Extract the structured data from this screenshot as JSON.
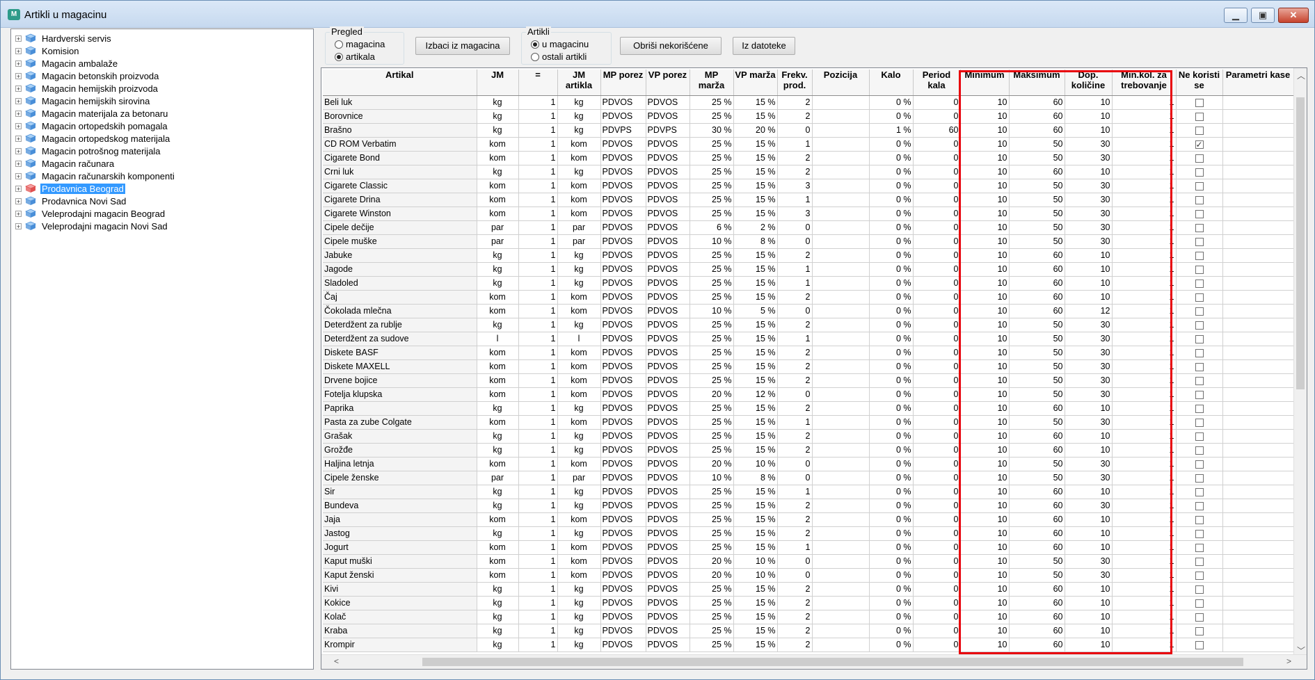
{
  "window": {
    "title": "Artikli u magacinu",
    "minimize": "▁",
    "maximize": "▣",
    "close": "✕",
    "app_icon_text": "M"
  },
  "tree": {
    "items": [
      {
        "label": "Hardverski servis"
      },
      {
        "label": "Komision"
      },
      {
        "label": "Magacin ambalaže"
      },
      {
        "label": "Magacin betonskih proizvoda"
      },
      {
        "label": "Magacin hemijskih proizvoda"
      },
      {
        "label": "Magacin hemijskih sirovina"
      },
      {
        "label": "Magacin materijala za betonaru"
      },
      {
        "label": "Magacin ortopedskih pomagala"
      },
      {
        "label": "Magacin ortopedskog materijala"
      },
      {
        "label": "Magacin potrošnog materijala"
      },
      {
        "label": "Magacin računara"
      },
      {
        "label": "Magacin računarskih komponenti"
      },
      {
        "label": "Prodavnica Beograd",
        "selected": true
      },
      {
        "label": "Prodavnica Novi Sad"
      },
      {
        "label": "Veleprodajni magacin Beograd"
      },
      {
        "label": "Veleprodajni magacin Novi Sad"
      }
    ]
  },
  "pregled": {
    "title": "Pregled",
    "opt1": "magacina",
    "opt2": "artikala",
    "selected": "artikala"
  },
  "izbaci_button": "Izbaci iz magacina",
  "artikli": {
    "title": "Artikli",
    "opt1": "u magacinu",
    "opt2": "ostali artikli",
    "selected": "u magacinu"
  },
  "obrisi_button": "Obriši nekorišćene",
  "iz_datoteke_button": "Iz datoteke",
  "columns": [
    "Artikal",
    "JM",
    "=",
    "JM artikla",
    "MP porez",
    "VP porez",
    "MP marža",
    "VP marža",
    "Frekv. prod.",
    "Pozicija",
    "Kalo",
    "Period kala",
    "Minimum",
    "Maksimum",
    "Dop. količine",
    "Min.kol. za trebovanje",
    "Ne koristi se",
    "Parametri kase"
  ],
  "rows": [
    [
      "Beli luk",
      "kg",
      "1",
      "kg",
      "PDVOS",
      "PDVOS",
      "25 %",
      "15 %",
      "2",
      "",
      "0 %",
      "0",
      "10",
      "60",
      "10",
      "1",
      false
    ],
    [
      "Borovnice",
      "kg",
      "1",
      "kg",
      "PDVOS",
      "PDVOS",
      "25 %",
      "15 %",
      "2",
      "",
      "0 %",
      "0",
      "10",
      "60",
      "10",
      "1",
      false
    ],
    [
      "Brašno",
      "kg",
      "1",
      "kg",
      "PDVPS",
      "PDVPS",
      "30 %",
      "20 %",
      "0",
      "",
      "1 %",
      "60",
      "10",
      "60",
      "10",
      "1",
      false
    ],
    [
      "CD ROM Verbatim",
      "kom",
      "1",
      "kom",
      "PDVOS",
      "PDVOS",
      "25 %",
      "15 %",
      "1",
      "",
      "0 %",
      "0",
      "10",
      "50",
      "30",
      "1",
      true
    ],
    [
      "Cigarete Bond",
      "kom",
      "1",
      "kom",
      "PDVOS",
      "PDVOS",
      "25 %",
      "15 %",
      "2",
      "",
      "0 %",
      "0",
      "10",
      "50",
      "30",
      "1",
      false
    ],
    [
      "Crni luk",
      "kg",
      "1",
      "kg",
      "PDVOS",
      "PDVOS",
      "25 %",
      "15 %",
      "2",
      "",
      "0 %",
      "0",
      "10",
      "60",
      "10",
      "1",
      false
    ],
    [
      "Cigarete Classic",
      "kom",
      "1",
      "kom",
      "PDVOS",
      "PDVOS",
      "25 %",
      "15 %",
      "3",
      "",
      "0 %",
      "0",
      "10",
      "50",
      "30",
      "1",
      false
    ],
    [
      "Cigarete Drina",
      "kom",
      "1",
      "kom",
      "PDVOS",
      "PDVOS",
      "25 %",
      "15 %",
      "1",
      "",
      "0 %",
      "0",
      "10",
      "50",
      "30",
      "1",
      false
    ],
    [
      "Cigarete Winston",
      "kom",
      "1",
      "kom",
      "PDVOS",
      "PDVOS",
      "25 %",
      "15 %",
      "3",
      "",
      "0 %",
      "0",
      "10",
      "50",
      "30",
      "1",
      false
    ],
    [
      "Cipele dečije",
      "par",
      "1",
      "par",
      "PDVOS",
      "PDVOS",
      "6 %",
      "2 %",
      "0",
      "",
      "0 %",
      "0",
      "10",
      "50",
      "30",
      "1",
      false
    ],
    [
      "Cipele muške",
      "par",
      "1",
      "par",
      "PDVOS",
      "PDVOS",
      "10 %",
      "8 %",
      "0",
      "",
      "0 %",
      "0",
      "10",
      "50",
      "30",
      "1",
      false
    ],
    [
      "Jabuke",
      "kg",
      "1",
      "kg",
      "PDVOS",
      "PDVOS",
      "25 %",
      "15 %",
      "2",
      "",
      "0 %",
      "0",
      "10",
      "60",
      "10",
      "1",
      false
    ],
    [
      "Jagode",
      "kg",
      "1",
      "kg",
      "PDVOS",
      "PDVOS",
      "25 %",
      "15 %",
      "1",
      "",
      "0 %",
      "0",
      "10",
      "60",
      "10",
      "1",
      false
    ],
    [
      "Sladoled",
      "kg",
      "1",
      "kg",
      "PDVOS",
      "PDVOS",
      "25 %",
      "15 %",
      "1",
      "",
      "0 %",
      "0",
      "10",
      "60",
      "10",
      "1",
      false
    ],
    [
      "Čaj",
      "kom",
      "1",
      "kom",
      "PDVOS",
      "PDVOS",
      "25 %",
      "15 %",
      "2",
      "",
      "0 %",
      "0",
      "10",
      "60",
      "10",
      "1",
      false
    ],
    [
      "Čokolada mlečna",
      "kom",
      "1",
      "kom",
      "PDVOS",
      "PDVOS",
      "10 %",
      "5 %",
      "0",
      "",
      "0 %",
      "0",
      "10",
      "60",
      "12",
      "1",
      false
    ],
    [
      "Deterdžent za rublje",
      "kg",
      "1",
      "kg",
      "PDVOS",
      "PDVOS",
      "25 %",
      "15 %",
      "2",
      "",
      "0 %",
      "0",
      "10",
      "50",
      "30",
      "1",
      false
    ],
    [
      "Deterdžent za sudove",
      "l",
      "1",
      "l",
      "PDVOS",
      "PDVOS",
      "25 %",
      "15 %",
      "1",
      "",
      "0 %",
      "0",
      "10",
      "50",
      "30",
      "1",
      false
    ],
    [
      "Diskete BASF",
      "kom",
      "1",
      "kom",
      "PDVOS",
      "PDVOS",
      "25 %",
      "15 %",
      "2",
      "",
      "0 %",
      "0",
      "10",
      "50",
      "30",
      "1",
      false
    ],
    [
      "Diskete MAXELL",
      "kom",
      "1",
      "kom",
      "PDVOS",
      "PDVOS",
      "25 %",
      "15 %",
      "2",
      "",
      "0 %",
      "0",
      "10",
      "50",
      "30",
      "1",
      false
    ],
    [
      "Drvene bojice",
      "kom",
      "1",
      "kom",
      "PDVOS",
      "PDVOS",
      "25 %",
      "15 %",
      "2",
      "",
      "0 %",
      "0",
      "10",
      "50",
      "30",
      "1",
      false
    ],
    [
      "Fotelja klupska",
      "kom",
      "1",
      "kom",
      "PDVOS",
      "PDVOS",
      "20 %",
      "12 %",
      "0",
      "",
      "0 %",
      "0",
      "10",
      "50",
      "30",
      "1",
      false
    ],
    [
      "Paprika",
      "kg",
      "1",
      "kg",
      "PDVOS",
      "PDVOS",
      "25 %",
      "15 %",
      "2",
      "",
      "0 %",
      "0",
      "10",
      "60",
      "10",
      "1",
      false
    ],
    [
      "Pasta za zube Colgate",
      "kom",
      "1",
      "kom",
      "PDVOS",
      "PDVOS",
      "25 %",
      "15 %",
      "1",
      "",
      "0 %",
      "0",
      "10",
      "50",
      "30",
      "1",
      false
    ],
    [
      "Grašak",
      "kg",
      "1",
      "kg",
      "PDVOS",
      "PDVOS",
      "25 %",
      "15 %",
      "2",
      "",
      "0 %",
      "0",
      "10",
      "60",
      "10",
      "1",
      false
    ],
    [
      "Grožđe",
      "kg",
      "1",
      "kg",
      "PDVOS",
      "PDVOS",
      "25 %",
      "15 %",
      "2",
      "",
      "0 %",
      "0",
      "10",
      "60",
      "10",
      "1",
      false
    ],
    [
      "Haljina letnja",
      "kom",
      "1",
      "kom",
      "PDVOS",
      "PDVOS",
      "20 %",
      "10 %",
      "0",
      "",
      "0 %",
      "0",
      "10",
      "50",
      "30",
      "1",
      false
    ],
    [
      "Cipele ženske",
      "par",
      "1",
      "par",
      "PDVOS",
      "PDVOS",
      "10 %",
      "8 %",
      "0",
      "",
      "0 %",
      "0",
      "10",
      "50",
      "30",
      "1",
      false
    ],
    [
      "Sir",
      "kg",
      "1",
      "kg",
      "PDVOS",
      "PDVOS",
      "25 %",
      "15 %",
      "1",
      "",
      "0 %",
      "0",
      "10",
      "60",
      "10",
      "1",
      false
    ],
    [
      "Bundeva",
      "kg",
      "1",
      "kg",
      "PDVOS",
      "PDVOS",
      "25 %",
      "15 %",
      "2",
      "",
      "0 %",
      "0",
      "10",
      "60",
      "30",
      "1",
      false
    ],
    [
      "Jaja",
      "kom",
      "1",
      "kom",
      "PDVOS",
      "PDVOS",
      "25 %",
      "15 %",
      "2",
      "",
      "0 %",
      "0",
      "10",
      "60",
      "10",
      "1",
      false
    ],
    [
      "Jastog",
      "kg",
      "1",
      "kg",
      "PDVOS",
      "PDVOS",
      "25 %",
      "15 %",
      "2",
      "",
      "0 %",
      "0",
      "10",
      "60",
      "10",
      "1",
      false
    ],
    [
      "Jogurt",
      "kom",
      "1",
      "kom",
      "PDVOS",
      "PDVOS",
      "25 %",
      "15 %",
      "1",
      "",
      "0 %",
      "0",
      "10",
      "60",
      "10",
      "1",
      false
    ],
    [
      "Kaput muški",
      "kom",
      "1",
      "kom",
      "PDVOS",
      "PDVOS",
      "20 %",
      "10 %",
      "0",
      "",
      "0 %",
      "0",
      "10",
      "50",
      "30",
      "1",
      false
    ],
    [
      "Kaput ženski",
      "kom",
      "1",
      "kom",
      "PDVOS",
      "PDVOS",
      "20 %",
      "10 %",
      "0",
      "",
      "0 %",
      "0",
      "10",
      "50",
      "30",
      "1",
      false
    ],
    [
      "Kivi",
      "kg",
      "1",
      "kg",
      "PDVOS",
      "PDVOS",
      "25 %",
      "15 %",
      "2",
      "",
      "0 %",
      "0",
      "10",
      "60",
      "10",
      "1",
      false
    ],
    [
      "Kokice",
      "kg",
      "1",
      "kg",
      "PDVOS",
      "PDVOS",
      "25 %",
      "15 %",
      "2",
      "",
      "0 %",
      "0",
      "10",
      "60",
      "10",
      "1",
      false
    ],
    [
      "Kolač",
      "kg",
      "1",
      "kg",
      "PDVOS",
      "PDVOS",
      "25 %",
      "15 %",
      "2",
      "",
      "0 %",
      "0",
      "10",
      "60",
      "10",
      "1",
      false
    ],
    [
      "Kraba",
      "kg",
      "1",
      "kg",
      "PDVOS",
      "PDVOS",
      "25 %",
      "15 %",
      "2",
      "",
      "0 %",
      "0",
      "10",
      "60",
      "10",
      "1",
      false
    ],
    [
      "Krompir",
      "kg",
      "1",
      "kg",
      "PDVOS",
      "PDVOS",
      "25 %",
      "15 %",
      "2",
      "",
      "0 %",
      "0",
      "10",
      "60",
      "10",
      "1",
      false
    ]
  ],
  "highlight_color": "#e8000b",
  "selection_color": "#3399ff"
}
